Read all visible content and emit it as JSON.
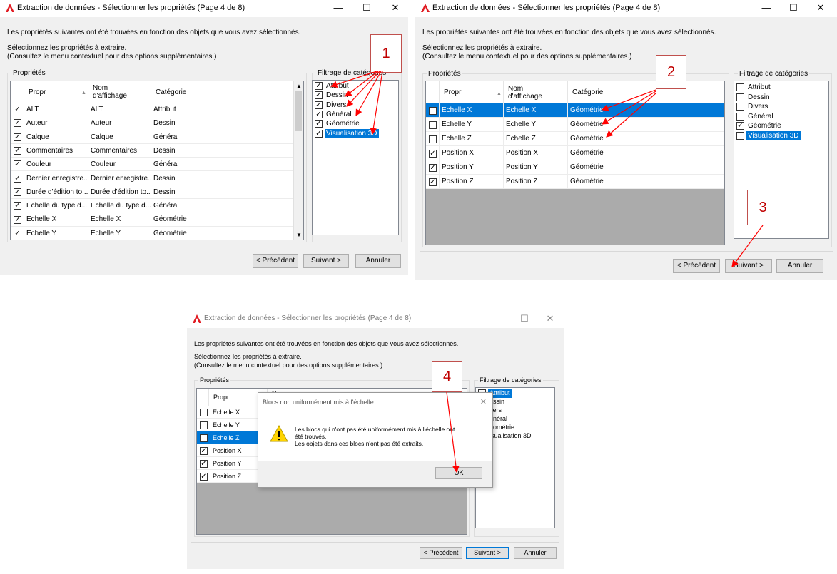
{
  "window": {
    "title": "Extraction de données - Sélectionner les propriétés (Page 4 de 8)",
    "minimize": "—",
    "maximize": "☐",
    "close": "✕"
  },
  "intro": {
    "line1": "Les propriétés suivantes ont été trouvées en fonction des objets que vous avez sélectionnés.",
    "line2": "Sélectionnez les propriétés à extraire.",
    "line3": "(Consultez le menu contextuel pour des options supplémentaires.)"
  },
  "group_props": "Propriétés",
  "group_filter": "Filtrage de catégories",
  "columns": {
    "propr": "Propr",
    "nom": "Nom\nd'affichage",
    "categorie": "Catégorie"
  },
  "columns_short": {
    "nom": "Nom"
  },
  "buttons": {
    "precedent": "< Précédent",
    "suivant": "Suivant >",
    "annuler": "Annuler"
  },
  "panel1": {
    "rows": [
      {
        "checked": true,
        "propr": "ALT",
        "nom": "ALT",
        "cat": "Attribut"
      },
      {
        "checked": true,
        "propr": "Auteur",
        "nom": "Auteur",
        "cat": "Dessin"
      },
      {
        "checked": true,
        "propr": "Calque",
        "nom": "Calque",
        "cat": "Général"
      },
      {
        "checked": true,
        "propr": "Commentaires",
        "nom": "Commentaires",
        "cat": "Dessin"
      },
      {
        "checked": true,
        "propr": "Couleur",
        "nom": "Couleur",
        "cat": "Général"
      },
      {
        "checked": true,
        "propr": "Dernier enregistre...",
        "nom": "Dernier enregistre...",
        "cat": "Dessin"
      },
      {
        "checked": true,
        "propr": "Durée d'édition to...",
        "nom": "Durée d'édition to...",
        "cat": "Dessin"
      },
      {
        "checked": true,
        "propr": "Echelle du type d...",
        "nom": "Echelle du type d...",
        "cat": "Général"
      },
      {
        "checked": true,
        "propr": "Echelle X",
        "nom": "Echelle X",
        "cat": "Géométrie"
      },
      {
        "checked": true,
        "propr": "Echelle Y",
        "nom": "Echelle Y",
        "cat": "Géométrie"
      }
    ],
    "filters": [
      {
        "checked": true,
        "label": "Attribut",
        "selected": false
      },
      {
        "checked": true,
        "label": "Dessin",
        "selected": false
      },
      {
        "checked": true,
        "label": "Divers",
        "selected": false
      },
      {
        "checked": true,
        "label": "Général",
        "selected": false
      },
      {
        "checked": true,
        "label": "Géométrie",
        "selected": false
      },
      {
        "checked": true,
        "label": "Visualisation 3D",
        "selected": true
      }
    ],
    "callout": "1"
  },
  "panel2": {
    "rows": [
      {
        "checked": false,
        "propr": "Echelle X",
        "nom": "Echelle X",
        "cat": "Géométrie",
        "selected": true
      },
      {
        "checked": false,
        "propr": "Echelle Y",
        "nom": "Echelle Y",
        "cat": "Géométrie",
        "selected": false
      },
      {
        "checked": false,
        "propr": "Echelle Z",
        "nom": "Echelle Z",
        "cat": "Géométrie",
        "selected": false
      },
      {
        "checked": true,
        "propr": "Position X",
        "nom": "Position X",
        "cat": "Géométrie",
        "selected": false
      },
      {
        "checked": true,
        "propr": "Position Y",
        "nom": "Position Y",
        "cat": "Géométrie",
        "selected": false
      },
      {
        "checked": true,
        "propr": "Position Z",
        "nom": "Position Z",
        "cat": "Géométrie",
        "selected": false
      }
    ],
    "filters": [
      {
        "checked": false,
        "label": "Attribut",
        "selected": false
      },
      {
        "checked": false,
        "label": "Dessin",
        "selected": false
      },
      {
        "checked": false,
        "label": "Divers",
        "selected": false
      },
      {
        "checked": false,
        "label": "Général",
        "selected": false
      },
      {
        "checked": true,
        "label": "Géométrie",
        "selected": false
      },
      {
        "checked": false,
        "label": "Visualisation 3D",
        "selected": true
      }
    ],
    "callout2": "2",
    "callout3": "3"
  },
  "panel3": {
    "rows": [
      {
        "checked": false,
        "propr": "Echelle X",
        "selected": false
      },
      {
        "checked": false,
        "propr": "Echelle Y",
        "selected": false
      },
      {
        "checked": false,
        "propr": "Echelle Z",
        "selected": true
      },
      {
        "checked": true,
        "propr": "Position X",
        "selected": false
      },
      {
        "checked": true,
        "propr": "Position Y",
        "selected": false
      },
      {
        "checked": true,
        "propr": "Position Z",
        "selected": false
      }
    ],
    "filters": [
      {
        "checked": false,
        "label": "Attribut",
        "selected": true
      },
      {
        "checked": false,
        "label": "essin",
        "selected": false
      },
      {
        "checked": false,
        "label": "vers",
        "selected": false
      },
      {
        "checked": false,
        "label": "énéral",
        "selected": false
      },
      {
        "checked": false,
        "label": "éométrie",
        "selected": false
      },
      {
        "checked": false,
        "label": "isualisation 3D",
        "selected": false
      }
    ],
    "callout": "4",
    "modal": {
      "title": "Blocs non uniformément mis à l'échelle",
      "close": "✕",
      "message1": "Les blocs qui n'ont pas été uniformément mis à l'échelle ont",
      "message2": "été trouvés.",
      "message3": "Les objets dans ces blocs n'ont pas été extraits.",
      "ok": "OK"
    }
  },
  "colors": {
    "accent": "#0078d7",
    "annotation": "#ff0000",
    "callout_border": "#c0504d",
    "grid_empty": "#ababab"
  }
}
